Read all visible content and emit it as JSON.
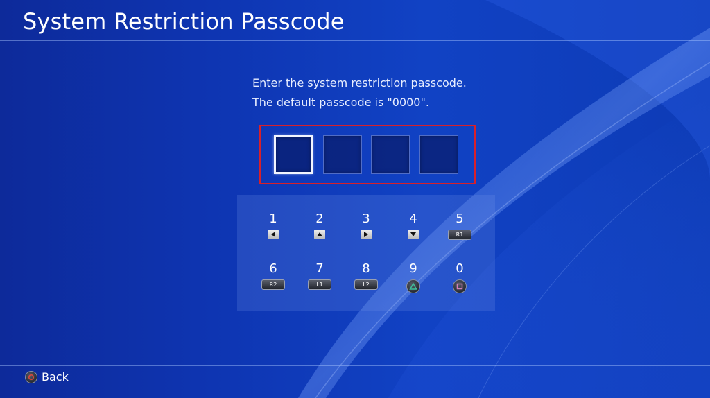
{
  "header": {
    "title": "System Restriction Passcode"
  },
  "instructions": {
    "line1": "Enter the system restriction passcode.",
    "line2": "The default passcode is \"0000\"."
  },
  "passcode": {
    "length": 4,
    "active_index": 0,
    "values": [
      "",
      "",
      "",
      ""
    ]
  },
  "keypad": {
    "keys": [
      {
        "digit": "1",
        "button": "left-arrow-icon"
      },
      {
        "digit": "2",
        "button": "up-arrow-icon"
      },
      {
        "digit": "3",
        "button": "right-arrow-icon"
      },
      {
        "digit": "4",
        "button": "down-arrow-icon"
      },
      {
        "digit": "5",
        "button": "r1-button-icon",
        "label": "R1"
      },
      {
        "digit": "6",
        "button": "r2-button-icon",
        "label": "R2"
      },
      {
        "digit": "7",
        "button": "l1-button-icon",
        "label": "L1"
      },
      {
        "digit": "8",
        "button": "l2-button-icon",
        "label": "L2"
      },
      {
        "digit": "9",
        "button": "triangle-button-icon"
      },
      {
        "digit": "0",
        "button": "square-button-icon"
      }
    ]
  },
  "footer": {
    "back_label": "Back",
    "back_icon": "circle-button-icon"
  },
  "colors": {
    "background": "#0e35b2",
    "highlight": "#d8202a",
    "triangle": "#3fbf9a",
    "square": "#d27fb8",
    "circle": "#e0463c"
  }
}
